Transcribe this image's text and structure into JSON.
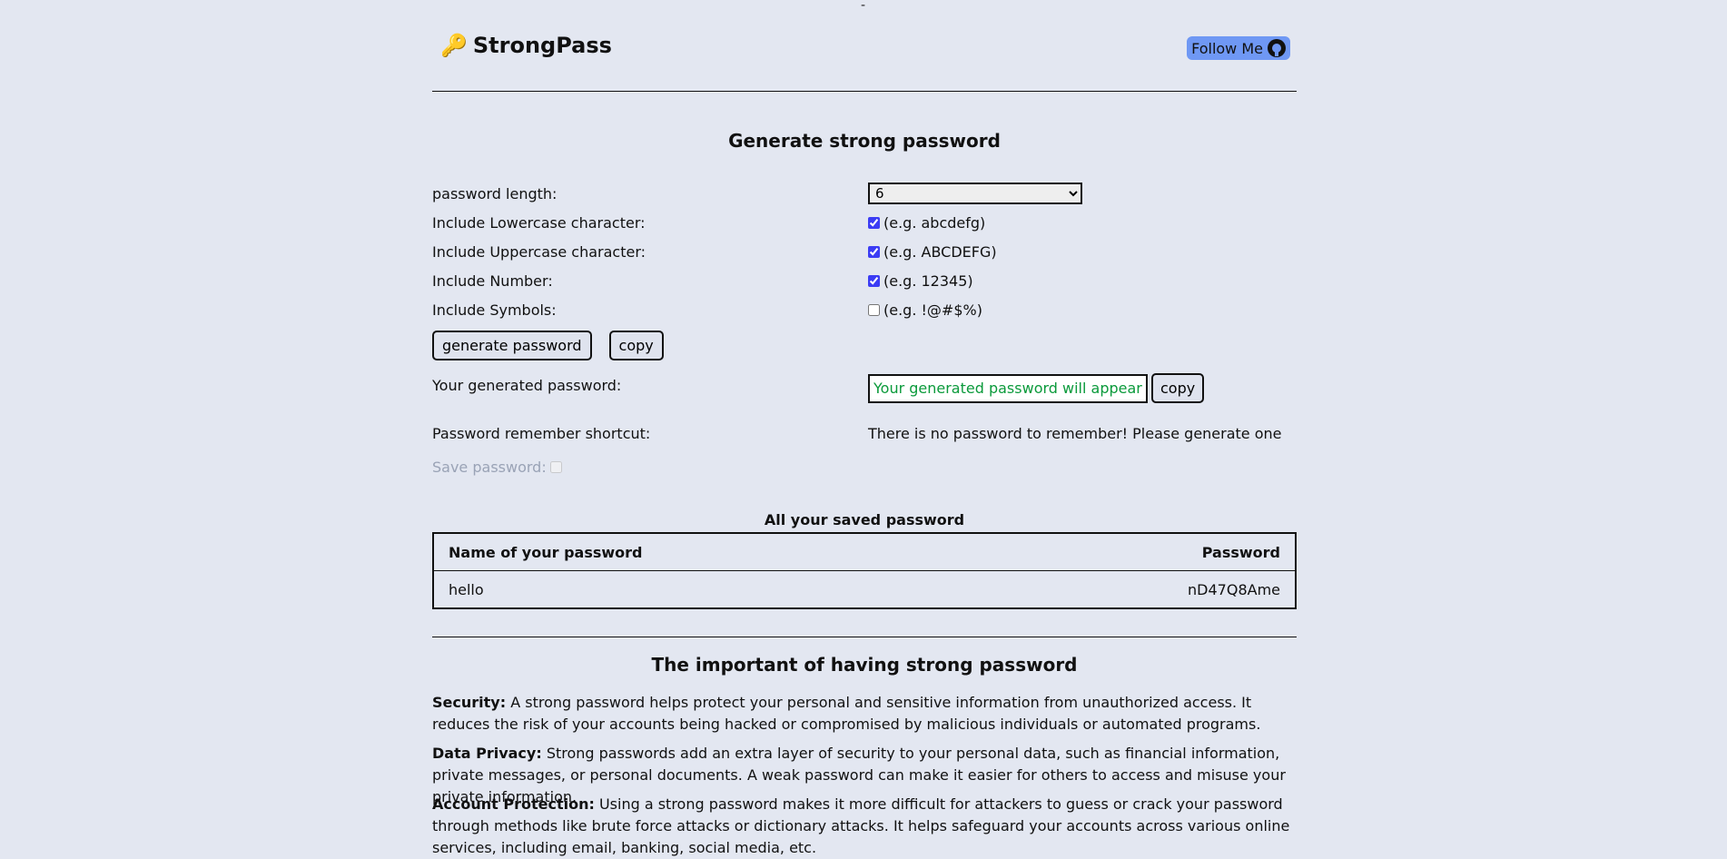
{
  "top_dash": "-",
  "header": {
    "brand_icon": "key-icon",
    "brand_emoji": "🔑",
    "brand_name": "StrongPass",
    "follow_label": "Follow Me",
    "follow_icon": "github-icon",
    "follow_color": "#6f98f4"
  },
  "generator": {
    "title": "Generate strong password",
    "length_label": "password length:",
    "length_value": "6",
    "lowercase_label": "Include Lowercase character:",
    "lowercase_example": "(e.g. abcdefg)",
    "lowercase_checked": true,
    "uppercase_label": "Include Uppercase character:",
    "uppercase_example": "(e.g. ABCDEFG)",
    "uppercase_checked": true,
    "number_label": "Include Number:",
    "number_example": "(e.g. 12345)",
    "number_checked": true,
    "symbols_label": "Include Symbols:",
    "symbols_example": "(e.g. !@#$%)",
    "symbols_checked": false,
    "generate_button": "generate password",
    "copy_button": "copy",
    "generated_label": "Your generated password:",
    "generated_placeholder": "Your generated password will appear here",
    "generated_copy_button": "copy",
    "shortcut_label": "Password remember shortcut:",
    "shortcut_value": "There is no password to remember! Please generate one",
    "save_label": "Save password:",
    "accent_color": "#0b9a3b"
  },
  "saved": {
    "title": "All your saved password",
    "columns": [
      "Name of your password",
      "Password"
    ],
    "rows": [
      {
        "name": "hello",
        "password": "nD47Q8Ame"
      }
    ]
  },
  "importance": {
    "title": "The important of having strong password",
    "paragraphs": [
      {
        "term": "Security:",
        "text": " A strong password helps protect your personal and sensitive information from unauthorized access. It reduces the risk of your accounts being hacked or compromised by malicious individuals or automated programs."
      },
      {
        "term": "Data Privacy:",
        "text": " Strong passwords add an extra layer of security to your personal data, such as financial information, private messages, or personal documents. A weak password can make it easier for others to access and misuse your private information."
      },
      {
        "term": "Account Protection:",
        "text": " Using a strong password makes it more difficult for attackers to guess or crack your password through methods like brute force attacks or dictionary attacks. It helps safeguard your accounts across various online services, including email, banking, social media, etc."
      }
    ]
  }
}
